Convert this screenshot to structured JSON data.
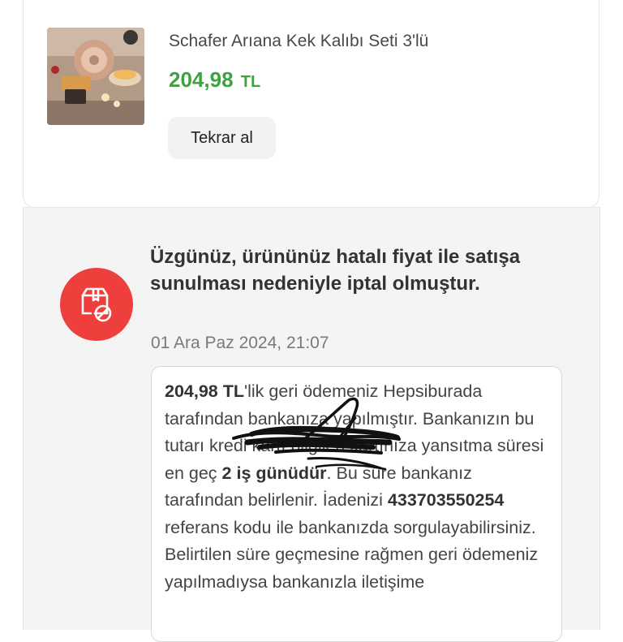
{
  "product": {
    "name": "Schafer Arıana Kek Kalıbı Seti 3'lü",
    "price_amount": "204,98",
    "price_currency": "TL",
    "buy_again_label": "Tekrar al"
  },
  "notice": {
    "title": "Üzgünüz, ürününüz hatalı fiyat ile satışa sunulması nedeniyle iptal olmuştur.",
    "date": "01 Ara Paz 2024, 21:07",
    "icon": "cancelled-package-icon",
    "icon_color": "#ee3f3c",
    "message": {
      "refund_amount": "204,98 TL",
      "part1": "'lik geri ödemeniz Hepsiburada tarafından bankanıza yapılmıştır. Bankanızın bu tutarı",
      "redacted_text": "kredi kartı bilgileri",
      "part2": "kartınıza yansıtma süresi en geç",
      "duration": "2 iş günüdür",
      "part3": ". Bu süre bankanız tarafından belirlenir. İadenizi",
      "reference_code": "433703550254",
      "part4": "referans kodu ile bankanızda sorgulayabilirsiniz. Belirtilen süre geçmesine rağmen geri ödemeniz yapılmadıysa bankanızla iletişime"
    }
  },
  "colors": {
    "price_green": "#3fa142",
    "alert_red": "#ee3f3c",
    "section_bg": "#f4f4f4"
  }
}
